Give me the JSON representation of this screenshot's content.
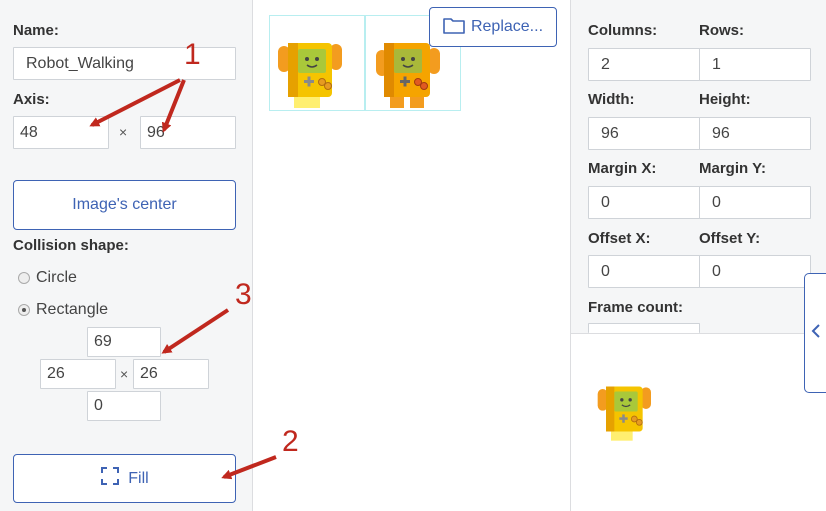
{
  "left": {
    "name_label": "Name:",
    "name_value": "Robot_Walking",
    "axis_label": "Axis:",
    "axis_x": "48",
    "axis_y": "96",
    "times_symbol": "×",
    "image_center_button": "Image's center",
    "collision_label": "Collision shape:",
    "shape_options": [
      "Circle",
      "Rectangle"
    ],
    "selected_shape": "Rectangle",
    "collision_top": "69",
    "collision_left": "26",
    "collision_right": "26",
    "collision_bottom": "0",
    "fill_button": "Fill"
  },
  "center": {
    "replace_button": "Replace..."
  },
  "right": {
    "columns_label": "Columns:",
    "columns_value": "2",
    "rows_label": "Rows:",
    "rows_value": "1",
    "width_label": "Width:",
    "width_value": "96",
    "height_label": "Height:",
    "height_value": "96",
    "margin_x_label": "Margin X:",
    "margin_x_value": "0",
    "margin_y_label": "Margin Y:",
    "margin_y_value": "0",
    "offset_x_label": "Offset X:",
    "offset_x_value": "0",
    "offset_y_label": "Offset Y:",
    "offset_y_value": "0",
    "frame_count_label": "Frame count:"
  },
  "annotations": [
    "1",
    "2",
    "3"
  ],
  "colors": {
    "accent": "#3e63b4",
    "annotation": "#c0281e",
    "robot_body": "#f5c400",
    "robot_body_dark": "#e6a100",
    "robot_screen": "#a9c83a",
    "robot_arm": "#f39c1f"
  },
  "icons": {
    "folder": "folder-icon",
    "fill": "fill-frame-icon",
    "collapse": "chevron-left-icon"
  }
}
